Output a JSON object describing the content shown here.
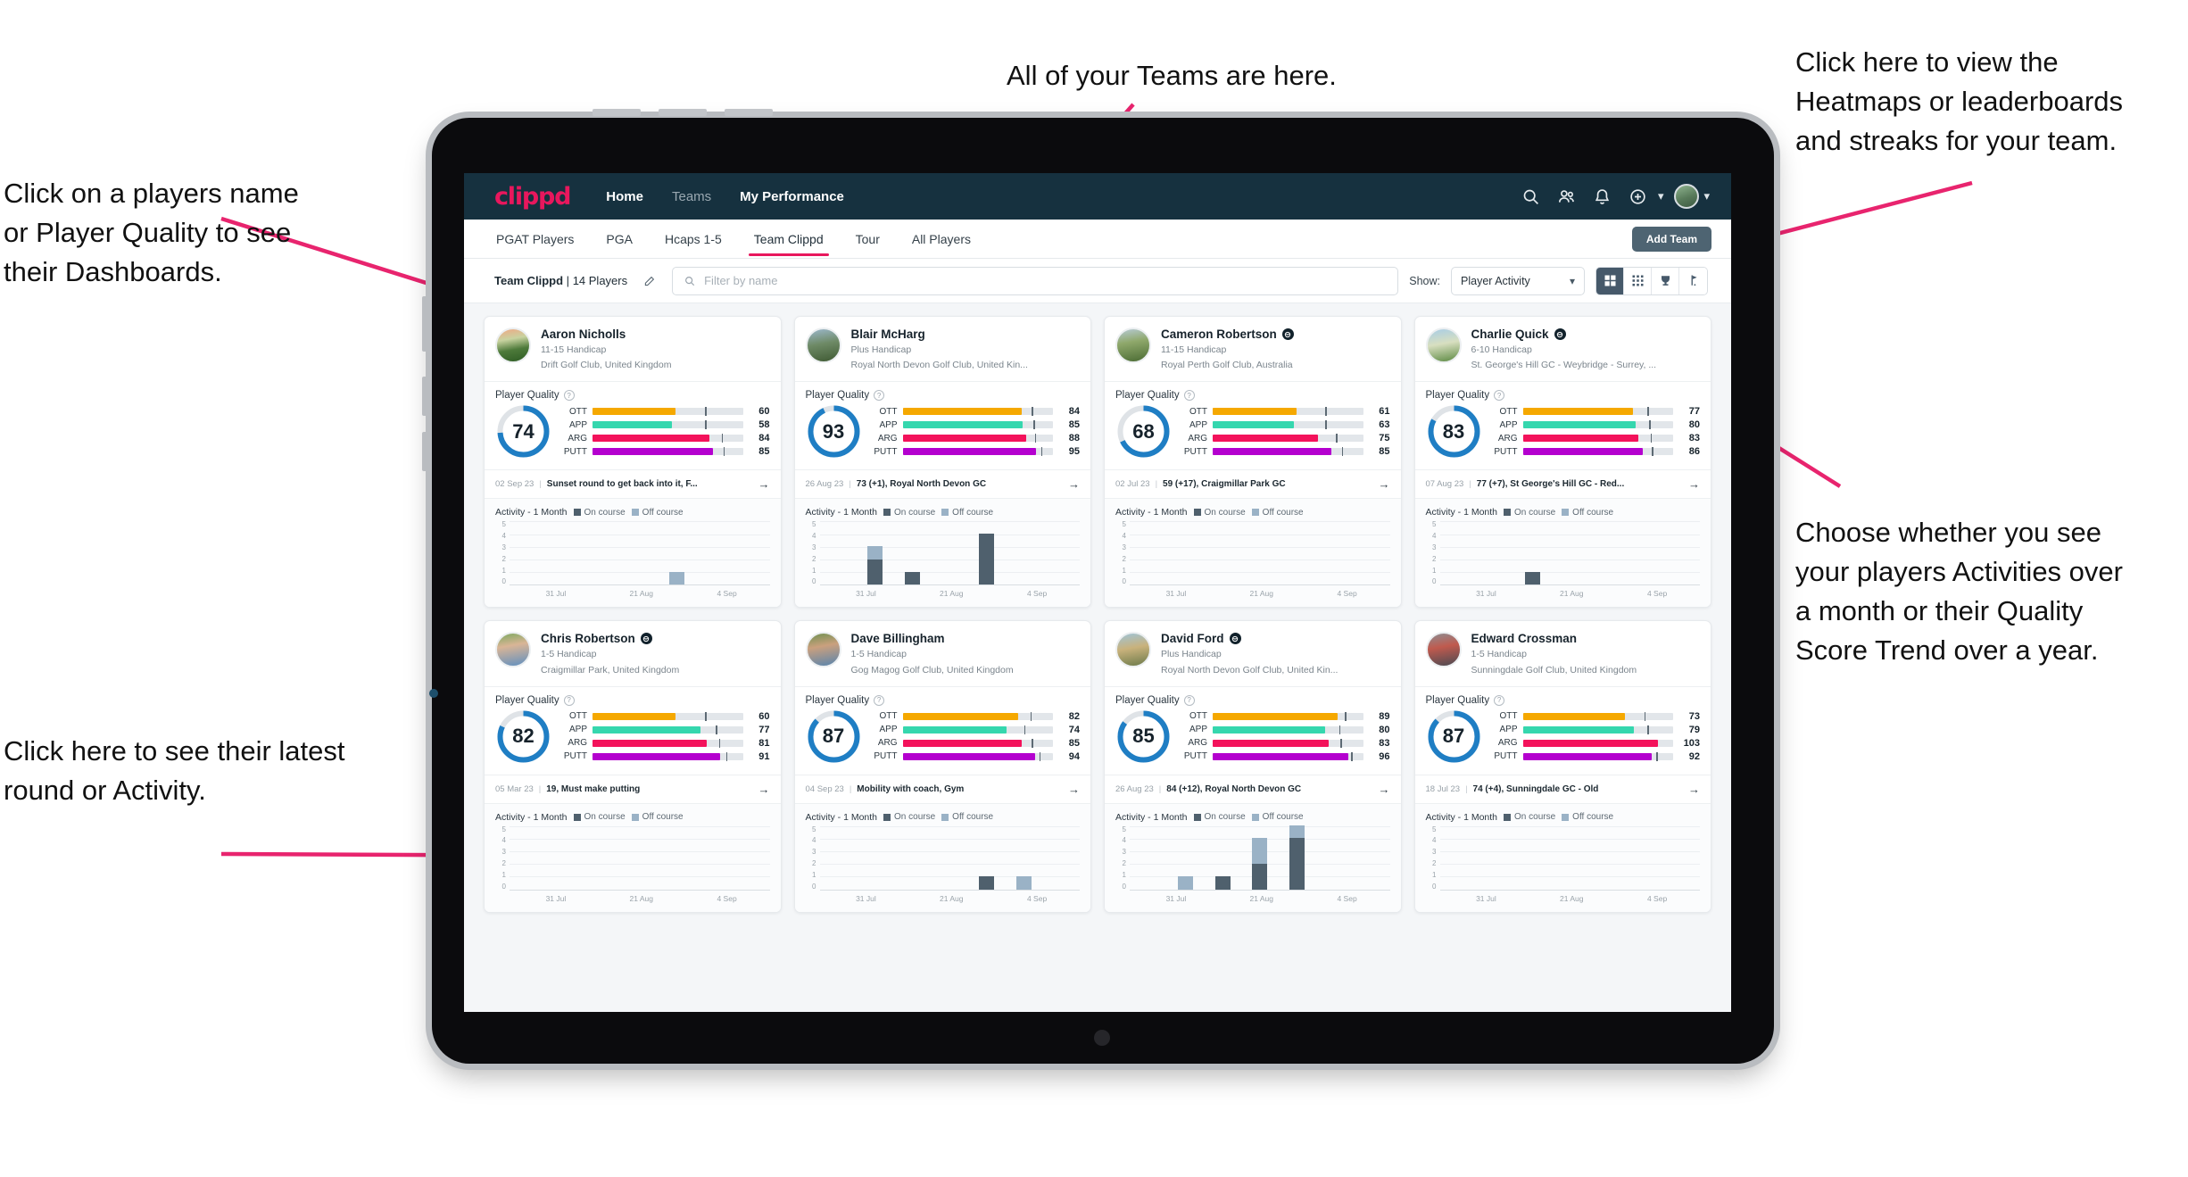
{
  "annotations": [
    {
      "id": "teams",
      "text": "All of your Teams are here."
    },
    {
      "id": "heatmaps",
      "text": "Click here to view the\nHeatmaps or leaderboards\nand streaks for your team."
    },
    {
      "id": "dashboards",
      "text": "Click on a players name\nor Player Quality to see\ntheir Dashboards."
    },
    {
      "id": "activity-toggle",
      "text": "Choose whether you see\nyour players Activities over\na month or their Quality\nScore Trend over a year."
    },
    {
      "id": "latest-round",
      "text": "Click here to see their latest\nround or Activity."
    }
  ],
  "colors": {
    "brand_pink": "#e8175d",
    "nav_dark": "#16313f",
    "ott": "#f5a800",
    "app": "#35d7ae",
    "arg": "#f3125b",
    "putt": "#b400cf",
    "ring": "#1f7ec4",
    "on_course": "#4f606d",
    "off_course": "#9ab2c6"
  },
  "topnav": {
    "brand": "clippd",
    "links": [
      {
        "label": "Home",
        "active": true
      },
      {
        "label": "Teams",
        "active": false
      },
      {
        "label": "My Performance",
        "active": true
      }
    ],
    "icons": [
      "search-icon",
      "people-icon",
      "bell-icon",
      "add-circle-icon",
      "avatar"
    ]
  },
  "subnav": {
    "tabs": [
      {
        "label": "PGAT Players",
        "active": false
      },
      {
        "label": "PGA",
        "active": false
      },
      {
        "label": "Hcaps 1-5",
        "active": false
      },
      {
        "label": "Team Clippd",
        "active": true
      },
      {
        "label": "Tour",
        "active": false
      },
      {
        "label": "All Players",
        "active": false
      }
    ],
    "add_team_label": "Add Team"
  },
  "toolbar": {
    "team_name": "Team Clippd",
    "team_count": "14 Players",
    "separator": "|",
    "search_placeholder": "Filter by name",
    "search_value": "",
    "show_label": "Show:",
    "show_value": "Player Activity",
    "show_options": [
      "Player Activity",
      "Quality Score Trend"
    ],
    "views": [
      {
        "name": "grid-view",
        "active": true
      },
      {
        "name": "table-view",
        "active": false
      },
      {
        "name": "trophy-view",
        "active": false
      },
      {
        "name": "flag-view",
        "active": false
      }
    ]
  },
  "card_labels": {
    "player_quality": "Player Quality",
    "activity": "Activity - 1 Month",
    "legend_on": "On course",
    "legend_off": "Off course",
    "metrics": [
      "OTT",
      "APP",
      "ARG",
      "PUTT"
    ]
  },
  "chart_data": {
    "type": "bar",
    "title": "Activity - 1 Month",
    "ylabel": "",
    "xlabel": "",
    "ylim": [
      0,
      5
    ],
    "yticks": [
      5,
      4,
      3,
      2,
      1,
      0
    ],
    "xticks": [
      "31 Jul",
      "21 Aug",
      "4 Sep"
    ],
    "legend": [
      "On course",
      "Off course"
    ],
    "legend_position": "top",
    "grid": true,
    "bins": 7
  },
  "players": [
    {
      "name": "Aaron Nicholls",
      "verified": false,
      "handicap": "11-15 Handicap",
      "club": "Drift Golf Club, United Kingdom",
      "quality": 74,
      "avatar_css": "linear-gradient(170deg,#f0a884 0%,#c8d3a0 32%,#4d7a3a 62%,#2e5c24 100%)",
      "metrics": [
        {
          "label": "OTT",
          "value": 60,
          "fill": 55,
          "tick": 75
        },
        {
          "label": "APP",
          "value": 58,
          "fill": 53,
          "tick": 75
        },
        {
          "label": "ARG",
          "value": 84,
          "fill": 78,
          "tick": 86
        },
        {
          "label": "PUTT",
          "value": 85,
          "fill": 80,
          "tick": 87
        }
      ],
      "latest_date": "02 Sep 23",
      "latest_text": "Sunset round to get back into it, F...",
      "bars": [
        {
          "on": 0,
          "off": 0
        },
        {
          "on": 0,
          "off": 0
        },
        {
          "on": 0,
          "off": 0
        },
        {
          "on": 0,
          "off": 0
        },
        {
          "on": 0,
          "off": 1
        },
        {
          "on": 0,
          "off": 0
        },
        {
          "on": 0,
          "off": 0
        }
      ]
    },
    {
      "name": "Blair McHarg",
      "verified": false,
      "handicap": "Plus Handicap",
      "club": "Royal North Devon Golf Club, United Kin...",
      "quality": 93,
      "avatar_css": "linear-gradient(170deg,#9cb8cc 0%,#6e8a66 45%,#3f5a33 100%)",
      "metrics": [
        {
          "label": "OTT",
          "value": 84,
          "fill": 79,
          "tick": 86
        },
        {
          "label": "APP",
          "value": 85,
          "fill": 80,
          "tick": 87
        },
        {
          "label": "ARG",
          "value": 88,
          "fill": 82,
          "tick": 88
        },
        {
          "label": "PUTT",
          "value": 95,
          "fill": 89,
          "tick": 92
        }
      ],
      "latest_date": "26 Aug 23",
      "latest_text": "73 (+1), Royal North Devon GC",
      "bars": [
        {
          "on": 0,
          "off": 0
        },
        {
          "on": 2,
          "off": 1
        },
        {
          "on": 1,
          "off": 0
        },
        {
          "on": 0,
          "off": 0
        },
        {
          "on": 4,
          "off": 0
        },
        {
          "on": 0,
          "off": 0
        },
        {
          "on": 0,
          "off": 0
        }
      ]
    },
    {
      "name": "Cameron Robertson",
      "verified": true,
      "handicap": "11-15 Handicap",
      "club": "Royal Perth Golf Club, Australia",
      "quality": 68,
      "avatar_css": "linear-gradient(170deg,#b7cbd6 0%,#8fa86b 40%,#4a6b33 100%)",
      "metrics": [
        {
          "label": "OTT",
          "value": 61,
          "fill": 56,
          "tick": 75
        },
        {
          "label": "APP",
          "value": 63,
          "fill": 54,
          "tick": 75
        },
        {
          "label": "ARG",
          "value": 75,
          "fill": 70,
          "tick": 82
        },
        {
          "label": "PUTT",
          "value": 85,
          "fill": 79,
          "tick": 86
        }
      ],
      "latest_date": "02 Jul 23",
      "latest_text": "59 (+17), Craigmillar Park GC",
      "bars": [
        {
          "on": 0,
          "off": 0
        },
        {
          "on": 0,
          "off": 0
        },
        {
          "on": 0,
          "off": 0
        },
        {
          "on": 0,
          "off": 0
        },
        {
          "on": 0,
          "off": 0
        },
        {
          "on": 0,
          "off": 0
        },
        {
          "on": 0,
          "off": 0
        }
      ]
    },
    {
      "name": "Charlie Quick",
      "verified": true,
      "handicap": "6-10 Handicap",
      "club": "St. George's Hill GC - Weybridge - Surrey, ...",
      "quality": 83,
      "avatar_css": "linear-gradient(170deg,#a8cde6 0%,#d8dfc0 45%,#5c8a42 100%)",
      "metrics": [
        {
          "label": "OTT",
          "value": 77,
          "fill": 73,
          "tick": 83
        },
        {
          "label": "APP",
          "value": 80,
          "fill": 75,
          "tick": 84
        },
        {
          "label": "ARG",
          "value": 83,
          "fill": 77,
          "tick": 85
        },
        {
          "label": "PUTT",
          "value": 86,
          "fill": 80,
          "tick": 86
        }
      ],
      "latest_date": "07 Aug 23",
      "latest_text": "77 (+7), St George's Hill GC - Red...",
      "bars": [
        {
          "on": 0,
          "off": 0
        },
        {
          "on": 0,
          "off": 0
        },
        {
          "on": 1,
          "off": 0
        },
        {
          "on": 0,
          "off": 0
        },
        {
          "on": 0,
          "off": 0
        },
        {
          "on": 0,
          "off": 0
        },
        {
          "on": 0,
          "off": 0
        }
      ]
    },
    {
      "name": "Chris Robertson",
      "verified": true,
      "handicap": "1-5 Handicap",
      "club": "Craigmillar Park, United Kingdom",
      "quality": 82,
      "avatar_css": "linear-gradient(170deg,#7da85f 0%,#d9b596 38%,#5f8fc0 100%)",
      "metrics": [
        {
          "label": "OTT",
          "value": 60,
          "fill": 55,
          "tick": 75
        },
        {
          "label": "APP",
          "value": 77,
          "fill": 72,
          "tick": 82
        },
        {
          "label": "ARG",
          "value": 81,
          "fill": 76,
          "tick": 84
        },
        {
          "label": "PUTT",
          "value": 91,
          "fill": 85,
          "tick": 89
        }
      ],
      "latest_date": "05 Mar 23",
      "latest_text": "19, Must make putting",
      "bars": [
        {
          "on": 0,
          "off": 0
        },
        {
          "on": 0,
          "off": 0
        },
        {
          "on": 0,
          "off": 0
        },
        {
          "on": 0,
          "off": 0
        },
        {
          "on": 0,
          "off": 0
        },
        {
          "on": 0,
          "off": 0
        },
        {
          "on": 0,
          "off": 0
        }
      ]
    },
    {
      "name": "Dave Billingham",
      "verified": false,
      "handicap": "1-5 Handicap",
      "club": "Gog Magog Golf Club, United Kingdom",
      "quality": 87,
      "avatar_css": "linear-gradient(170deg,#6f9050 0%,#caa07e 40%,#5884ad 100%)",
      "metrics": [
        {
          "label": "OTT",
          "value": 82,
          "fill": 77,
          "tick": 85
        },
        {
          "label": "APP",
          "value": 74,
          "fill": 69,
          "tick": 81
        },
        {
          "label": "ARG",
          "value": 85,
          "fill": 79,
          "tick": 86
        },
        {
          "label": "PUTT",
          "value": 94,
          "fill": 88,
          "tick": 91
        }
      ],
      "latest_date": "04 Sep 23",
      "latest_text": "Mobility with coach, Gym",
      "bars": [
        {
          "on": 0,
          "off": 0
        },
        {
          "on": 0,
          "off": 0
        },
        {
          "on": 0,
          "off": 0
        },
        {
          "on": 0,
          "off": 0
        },
        {
          "on": 1,
          "off": 0
        },
        {
          "on": 0,
          "off": 1
        },
        {
          "on": 0,
          "off": 0
        }
      ]
    },
    {
      "name": "David Ford",
      "verified": true,
      "handicap": "Plus Handicap",
      "club": "Royal North Devon Golf Club, United Kin...",
      "quality": 85,
      "avatar_css": "linear-gradient(170deg,#9fc4d8 0%,#c9b27c 45%,#6c7a4a 100%)",
      "metrics": [
        {
          "label": "OTT",
          "value": 89,
          "fill": 83,
          "tick": 88
        },
        {
          "label": "APP",
          "value": 80,
          "fill": 75,
          "tick": 84
        },
        {
          "label": "ARG",
          "value": 83,
          "fill": 77,
          "tick": 85
        },
        {
          "label": "PUTT",
          "value": 96,
          "fill": 90,
          "tick": 92
        }
      ],
      "latest_date": "26 Aug 23",
      "latest_text": "84 (+12), Royal North Devon GC",
      "bars": [
        {
          "on": 0,
          "off": 0
        },
        {
          "on": 0,
          "off": 1
        },
        {
          "on": 1,
          "off": 0
        },
        {
          "on": 2,
          "off": 2
        },
        {
          "on": 4,
          "off": 1
        },
        {
          "on": 0,
          "off": 0
        },
        {
          "on": 0,
          "off": 0
        }
      ]
    },
    {
      "name": "Edward Crossman",
      "verified": false,
      "handicap": "1-5 Handicap",
      "club": "Sunningdale Golf Club, United Kingdom",
      "quality": 87,
      "avatar_css": "linear-gradient(170deg,#8d8d92 0%,#c05a4e 42%,#4a4a52 100%)",
      "metrics": [
        {
          "label": "OTT",
          "value": 73,
          "fill": 68,
          "tick": 81
        },
        {
          "label": "APP",
          "value": 79,
          "fill": 74,
          "tick": 83
        },
        {
          "label": "ARG",
          "value": 103,
          "fill": 90,
          "tick": 0
        },
        {
          "label": "PUTT",
          "value": 92,
          "fill": 86,
          "tick": 89
        }
      ],
      "latest_date": "18 Jul 23",
      "latest_text": "74 (+4), Sunningdale GC - Old",
      "bars": [
        {
          "on": 0,
          "off": 0
        },
        {
          "on": 0,
          "off": 0
        },
        {
          "on": 0,
          "off": 0
        },
        {
          "on": 0,
          "off": 0
        },
        {
          "on": 0,
          "off": 0
        },
        {
          "on": 0,
          "off": 0
        },
        {
          "on": 0,
          "off": 0
        }
      ]
    }
  ]
}
